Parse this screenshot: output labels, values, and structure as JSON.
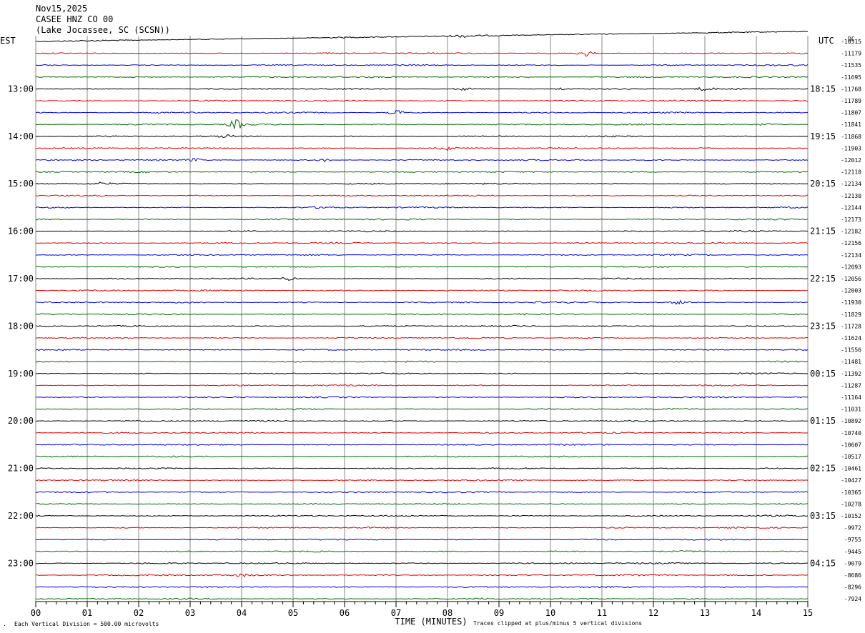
{
  "header": {
    "date": "Nov15,2025",
    "station": "CASEE HNZ CO 00",
    "location": "(Lake Jocassee, SC (SCSN))"
  },
  "chart_data": {
    "type": "helicorder",
    "left_timezone_label": "EST",
    "right_timezone_label": "UTC",
    "dc_column_label": "DC",
    "xlabel": "TIME (MINUTES)",
    "x_ticks": [
      "00",
      "01",
      "02",
      "03",
      "04",
      "05",
      "06",
      "07",
      "08",
      "09",
      "10",
      "11",
      "12",
      "13",
      "14",
      "15"
    ],
    "xlim": [
      0,
      15
    ],
    "row_minutes": 15,
    "trace_colors": [
      "#000000",
      "#dd0000",
      "#0000dd",
      "#006600"
    ],
    "left_hour_labels": [
      "13:00",
      "14:00",
      "15:00",
      "16:00",
      "17:00",
      "18:00",
      "19:00",
      "20:00",
      "21:00",
      "22:00",
      "23:00"
    ],
    "right_hour_labels": [
      "18:15",
      "19:15",
      "20:15",
      "21:15",
      "22:15",
      "23:15",
      "00:15",
      "01:15",
      "02:15",
      "03:15",
      "04:15"
    ],
    "dc_offsets": [
      "-10515",
      "-11179",
      "-11535",
      "-11695",
      "-11768",
      "-11789",
      "-11807",
      "-11841",
      "-11868",
      "-11903",
      "-12012",
      "-12110",
      "-12134",
      "-12130",
      "-12144",
      "-12173",
      "-12182",
      "-12156",
      "-12134",
      "-12093",
      "-12056",
      "-12003",
      "-11930",
      "-11829",
      "-11728",
      "-11624",
      "-11556",
      "-11481",
      "-11392",
      "-11287",
      "-11164",
      "-11031",
      "-10892",
      "-10740",
      "-10607",
      "-10517",
      "-10461",
      "-10427",
      "-10365",
      "-10278",
      "-10152",
      "-9972",
      "-9755",
      "-9445",
      "-9079",
      "-8686",
      "-8296",
      "-7924"
    ],
    "events": [
      {
        "row": 0,
        "minute": 8.3,
        "amplitude": 1.5
      },
      {
        "row": 1,
        "minute": 10.7,
        "amplitude": 4
      },
      {
        "row": 4,
        "minute": 8.3,
        "amplitude": 1.5
      },
      {
        "row": 4,
        "minute": 10.2,
        "amplitude": 1.5
      },
      {
        "row": 4,
        "minute": 13.0,
        "amplitude": 2
      },
      {
        "row": 6,
        "minute": 7.0,
        "amplitude": 3
      },
      {
        "row": 7,
        "minute": 3.9,
        "amplitude": 6
      },
      {
        "row": 7,
        "minute": 14.2,
        "amplitude": 1.5
      },
      {
        "row": 8,
        "minute": 3.7,
        "amplitude": 1.5
      },
      {
        "row": 9,
        "minute": 8.0,
        "amplitude": 2.5
      },
      {
        "row": 10,
        "minute": 3.1,
        "amplitude": 2
      },
      {
        "row": 10,
        "minute": 5.6,
        "amplitude": 2
      },
      {
        "row": 12,
        "minute": 1.3,
        "amplitude": 1.5
      },
      {
        "row": 14,
        "minute": 5.6,
        "amplitude": 1.5
      },
      {
        "row": 20,
        "minute": 4.9,
        "amplitude": 2
      },
      {
        "row": 22,
        "minute": 12.5,
        "amplitude": 2.5
      },
      {
        "row": 45,
        "minute": 4.0,
        "amplitude": 1.5
      },
      {
        "row": 47,
        "minute": 8.7,
        "amplitude": 1.5
      }
    ],
    "footer_left": "Each Vertical Division =  500.00 microvolts",
    "footer_right": "Traces clipped at plus/minus 5 vertical divisions"
  }
}
